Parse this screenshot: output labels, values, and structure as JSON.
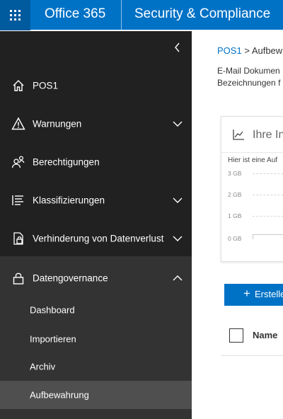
{
  "header": {
    "brand": "Office 365",
    "app_title": "Security & Compliance"
  },
  "sidebar": {
    "items": [
      {
        "label": "POS1",
        "icon": "home-icon"
      },
      {
        "label": "Warnungen",
        "icon": "warning-icon"
      },
      {
        "label": "Berechtigungen",
        "icon": "permissions-icon"
      },
      {
        "label": "Klassifizierungen",
        "icon": "list-icon"
      },
      {
        "label": "Verhinderung von Datenverlust",
        "icon": "dlp-icon"
      },
      {
        "label": "Datengovernance",
        "icon": "lock-icon"
      }
    ],
    "sub_items": [
      {
        "label": "Dashboard"
      },
      {
        "label": "Importieren"
      },
      {
        "label": "Archiv"
      },
      {
        "label": "Aufbewahrung"
      }
    ],
    "active_item": "Aufbewahrung"
  },
  "main": {
    "breadcrumb_home": "POS1",
    "breadcrumb_sep": ">",
    "breadcrumb_current": "Aufbew",
    "desc_line1": "E-Mail Dokumen",
    "desc_line2": "Bezeichnungen f",
    "card_title": "Ihre In",
    "card_subtitle": "Hier ist eine Auf",
    "y_ticks": [
      "3 GB",
      "2 GB",
      "1 GB",
      "0 GB"
    ],
    "create_label": "Erstelle",
    "column_name": "Name"
  },
  "colors": {
    "accent": "#0072c6",
    "sidebar_bg": "#212121",
    "sidebar_expanded_bg": "#333333",
    "active_bg": "#4f4f4f"
  }
}
